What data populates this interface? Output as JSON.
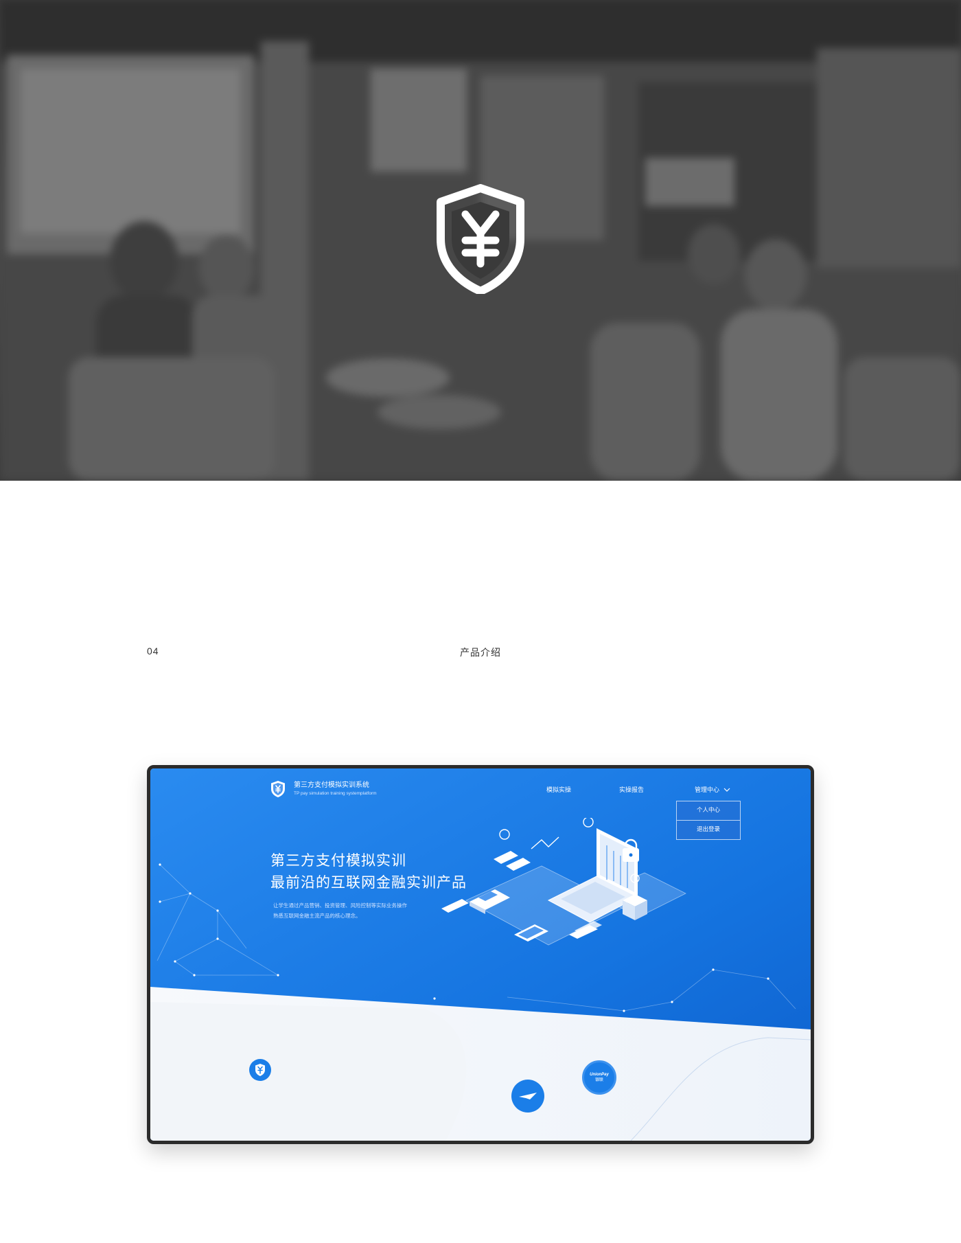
{
  "section": {
    "number": "04",
    "title": "产品介绍"
  },
  "mockup": {
    "brand": {
      "title": "第三方支付模拟实训系统",
      "subtitle": "TP pay simulation training systemplatform"
    },
    "nav": {
      "item1": "模拟实操",
      "item2": "实操报告",
      "item3": "管理中心"
    },
    "dropdown": {
      "item1": "个人中心",
      "item2": "退出登录"
    },
    "hero": {
      "line1": "第三方支付模拟实训",
      "line2": "最前沿的互联网金融实训产品",
      "desc1": "让学生通过产品营销、投资管理、风险控制等实际业务操作",
      "desc2": "熟悉互联网金融主流产品的核心理念。"
    },
    "unionpay": {
      "line1": "UnionPay",
      "line2": "银联"
    }
  },
  "colors": {
    "primary_blue": "#1a7be6",
    "deep_blue": "#0f5fd0",
    "hero_gray": "#444444"
  }
}
